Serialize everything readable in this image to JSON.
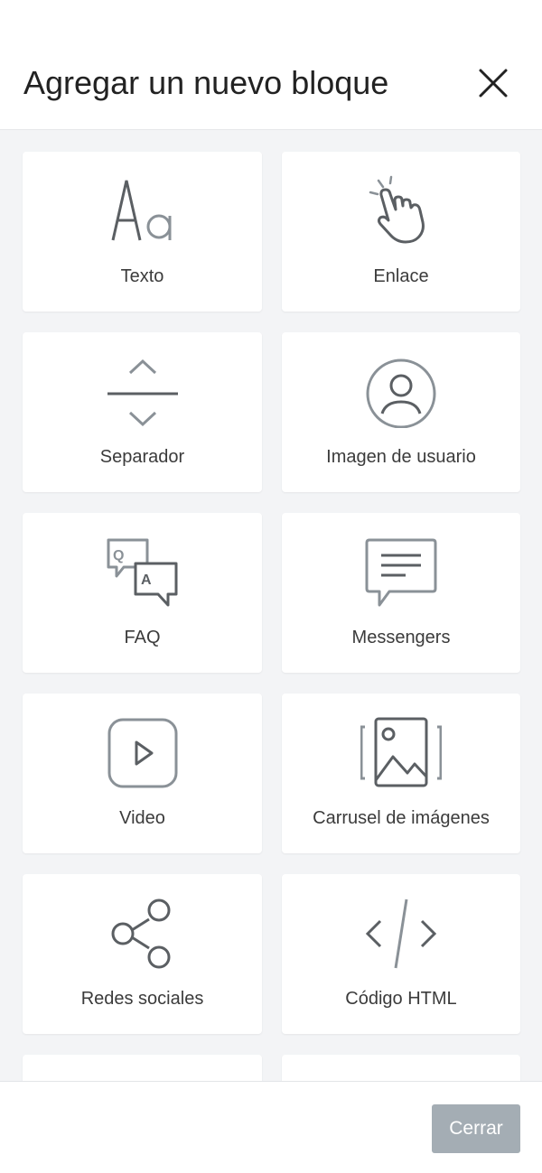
{
  "header": {
    "title": "Agregar un nuevo bloque",
    "close_icon": "close-icon"
  },
  "blocks": [
    {
      "label": "Texto",
      "icon": "text-aa-icon"
    },
    {
      "label": "Enlace",
      "icon": "hand-pointer-icon"
    },
    {
      "label": "Separador",
      "icon": "separator-icon"
    },
    {
      "label": "Imagen de usuario",
      "icon": "user-avatar-icon"
    },
    {
      "label": "FAQ",
      "icon": "faq-bubbles-icon"
    },
    {
      "label": "Messengers",
      "icon": "message-bubble-icon"
    },
    {
      "label": "Video",
      "icon": "video-play-icon"
    },
    {
      "label": "Carrusel de imágenes",
      "icon": "image-carousel-icon"
    },
    {
      "label": "Redes sociales",
      "icon": "share-icon"
    },
    {
      "label": "Código HTML",
      "icon": "code-icon"
    }
  ],
  "footer": {
    "close_label": "Cerrar"
  },
  "colors": {
    "background": "#f3f4f6",
    "card": "#ffffff",
    "icon_dark": "#5b5f63",
    "icon_light": "#8a9197",
    "button": "#a4adb4"
  }
}
